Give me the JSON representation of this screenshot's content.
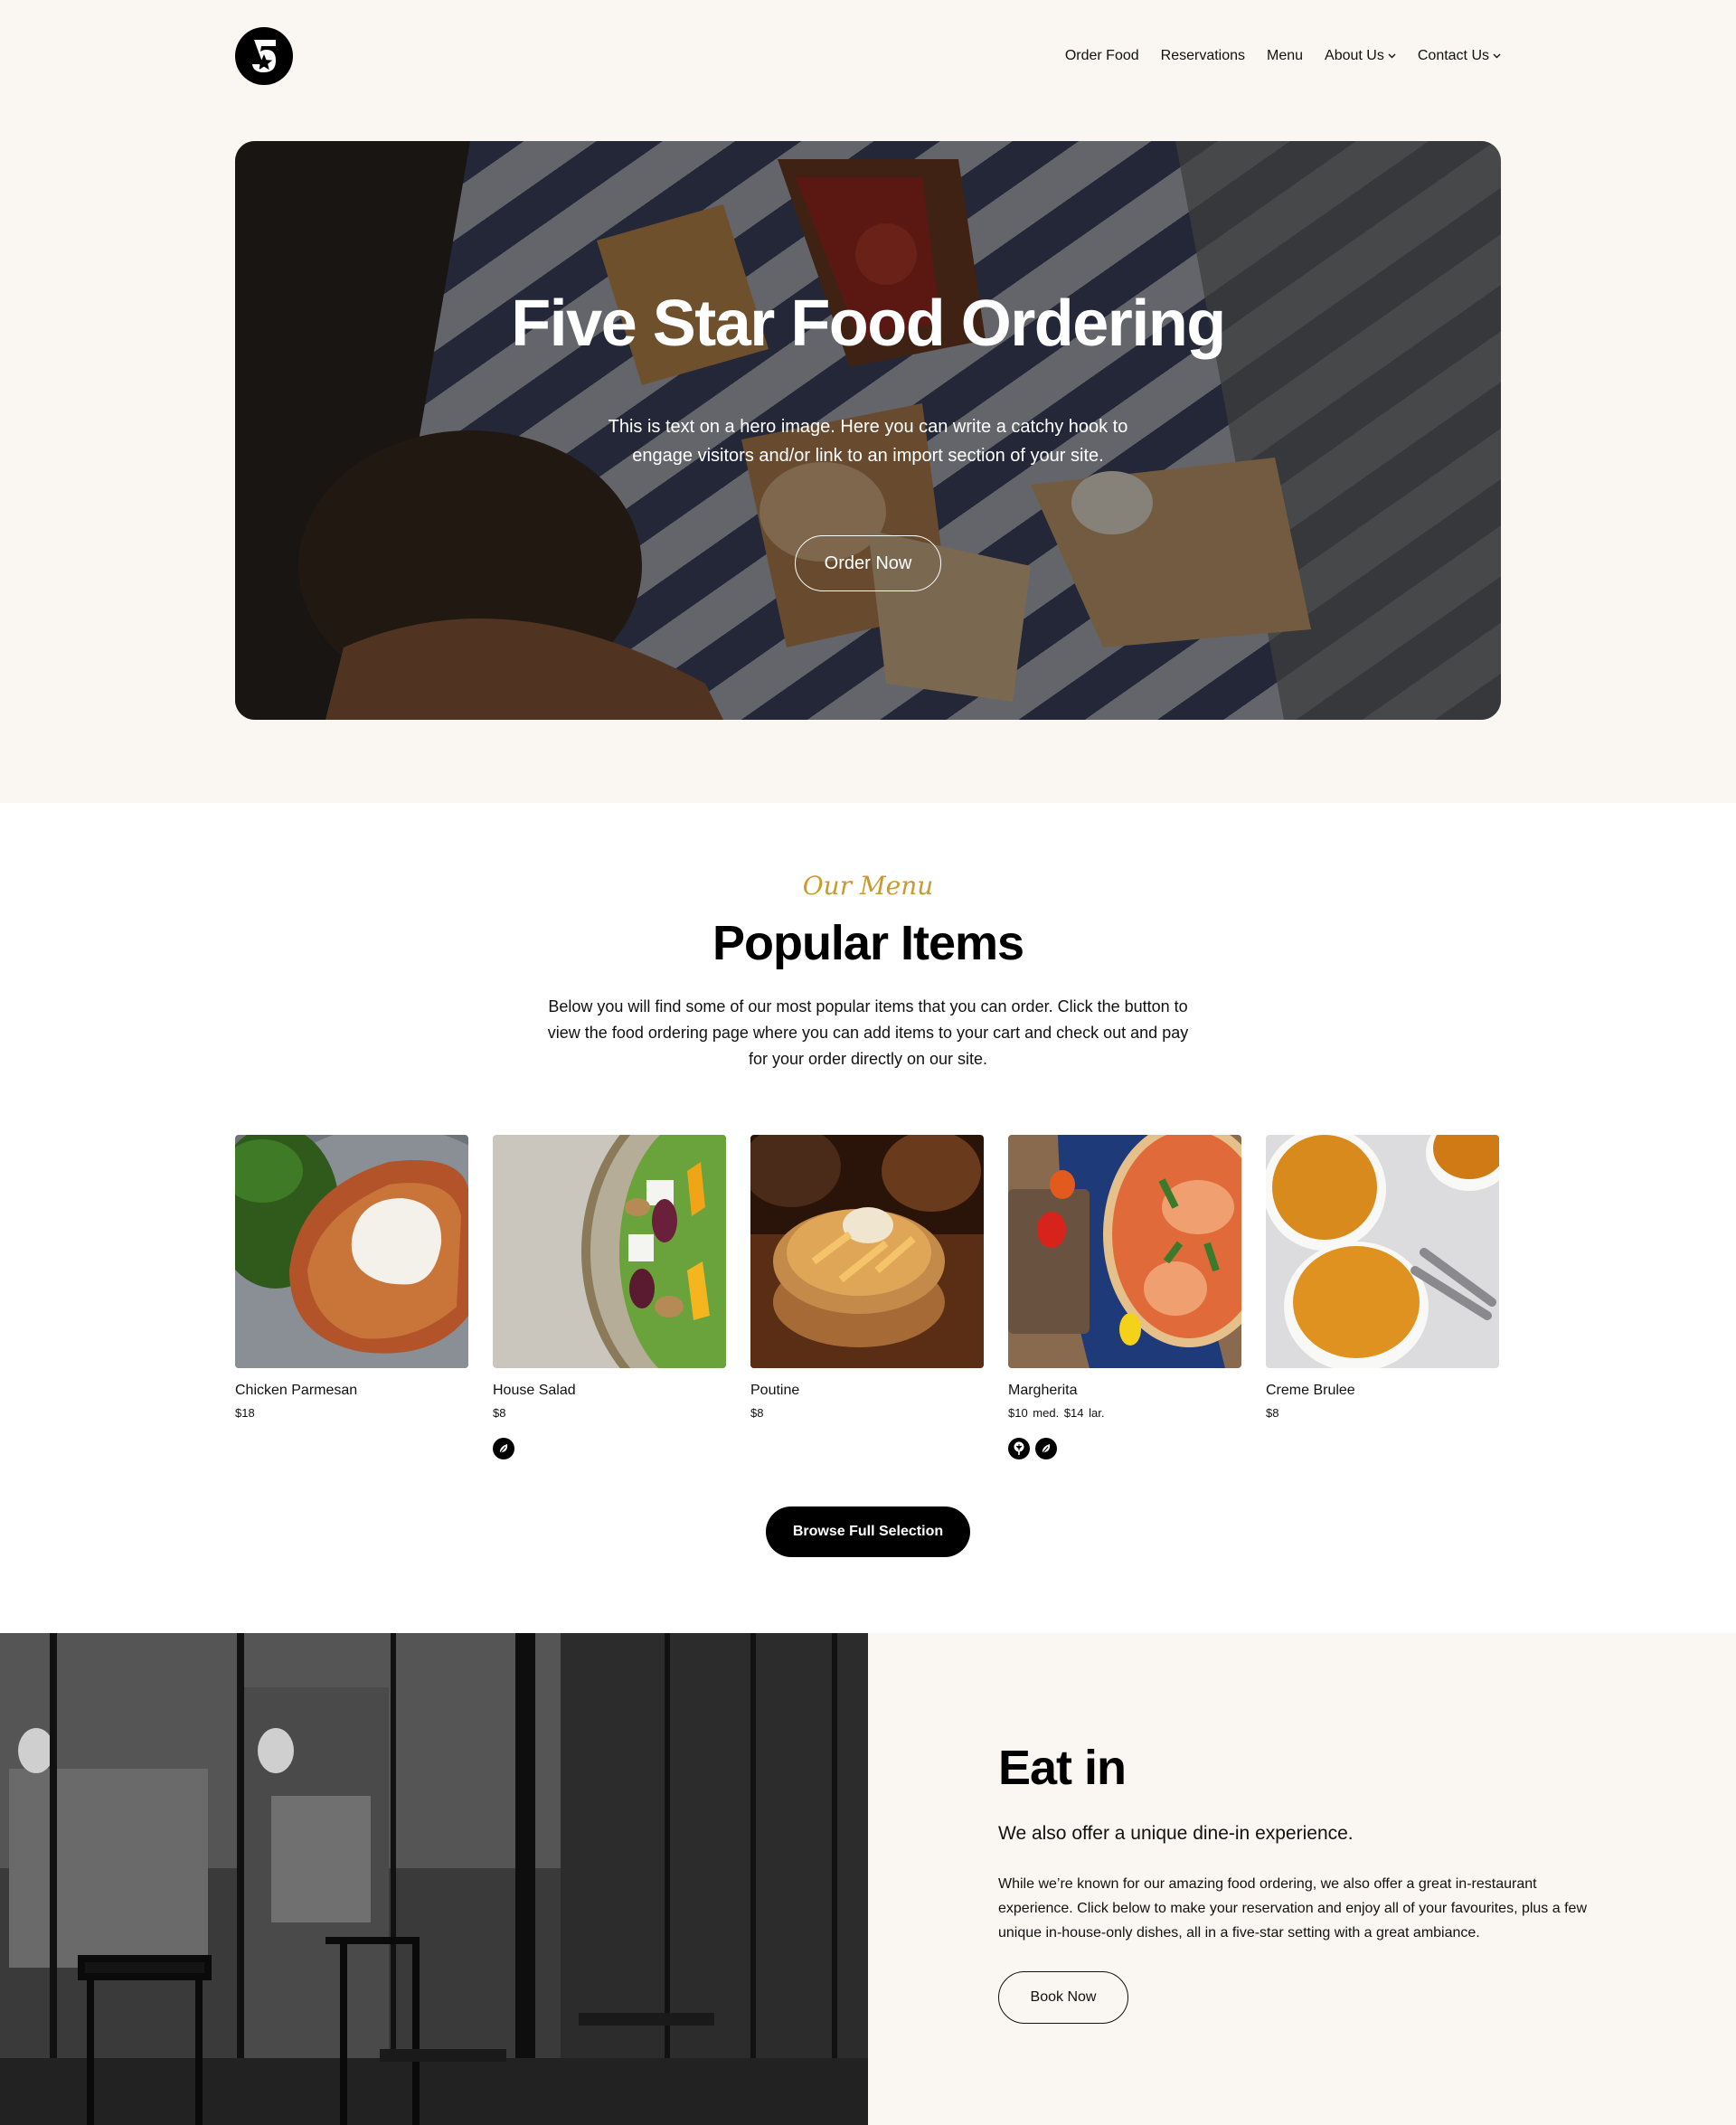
{
  "header": {
    "logo_label": "5",
    "nav": [
      {
        "label": "Order Food",
        "has_dropdown": false
      },
      {
        "label": "Reservations",
        "has_dropdown": false
      },
      {
        "label": "Menu",
        "has_dropdown": false
      },
      {
        "label": "About Us",
        "has_dropdown": true
      },
      {
        "label": "Contact Us",
        "has_dropdown": true
      }
    ],
    "dropdown_glyph": "⌄"
  },
  "hero": {
    "title": "Five Star Food Ordering",
    "subtitle": "This is text on a hero image. Here you can write a catchy hook to engage visitors and/or link to an import section of your site.",
    "button_label": "Order Now"
  },
  "menu_section": {
    "eyebrow": "Our Menu",
    "title": "Popular Items",
    "description": "Below you will find some of our most popular items that you can order. Click the button to view the food ordering page where you can add items to your cart and check out and pay for your order directly on our site.",
    "items": [
      {
        "name": "Chicken Parmesan",
        "price": "$18",
        "badges": []
      },
      {
        "name": "House Salad",
        "price": "$8",
        "badges": [
          "vegan-leaf-icon"
        ]
      },
      {
        "name": "Poutine",
        "price": "$8",
        "badges": []
      },
      {
        "name": "Margherita",
        "price": "$10 med.  $14 lar.",
        "badges": [
          "vegetarian-tree-icon",
          "vegan-leaf-icon"
        ]
      },
      {
        "name": "Creme Brulee",
        "price": "$8",
        "badges": []
      }
    ],
    "browse_button": "Browse Full Selection"
  },
  "eat_in": {
    "title": "Eat in",
    "subtitle": "We also offer a unique dine-in experience.",
    "description": "While we’re known for our amazing food ordering, we also offer a great in-restaurant experience. Click below to make your reservation and enjoy all of your favourites, plus a few unique in-house-only dishes, all in a five-star setting with a great ambiance.",
    "button_label": "Book Now"
  },
  "colors": {
    "page_bg_warm": "#faf7f2",
    "accent_gold": "#c99a2e",
    "button_dark": "#000000"
  }
}
